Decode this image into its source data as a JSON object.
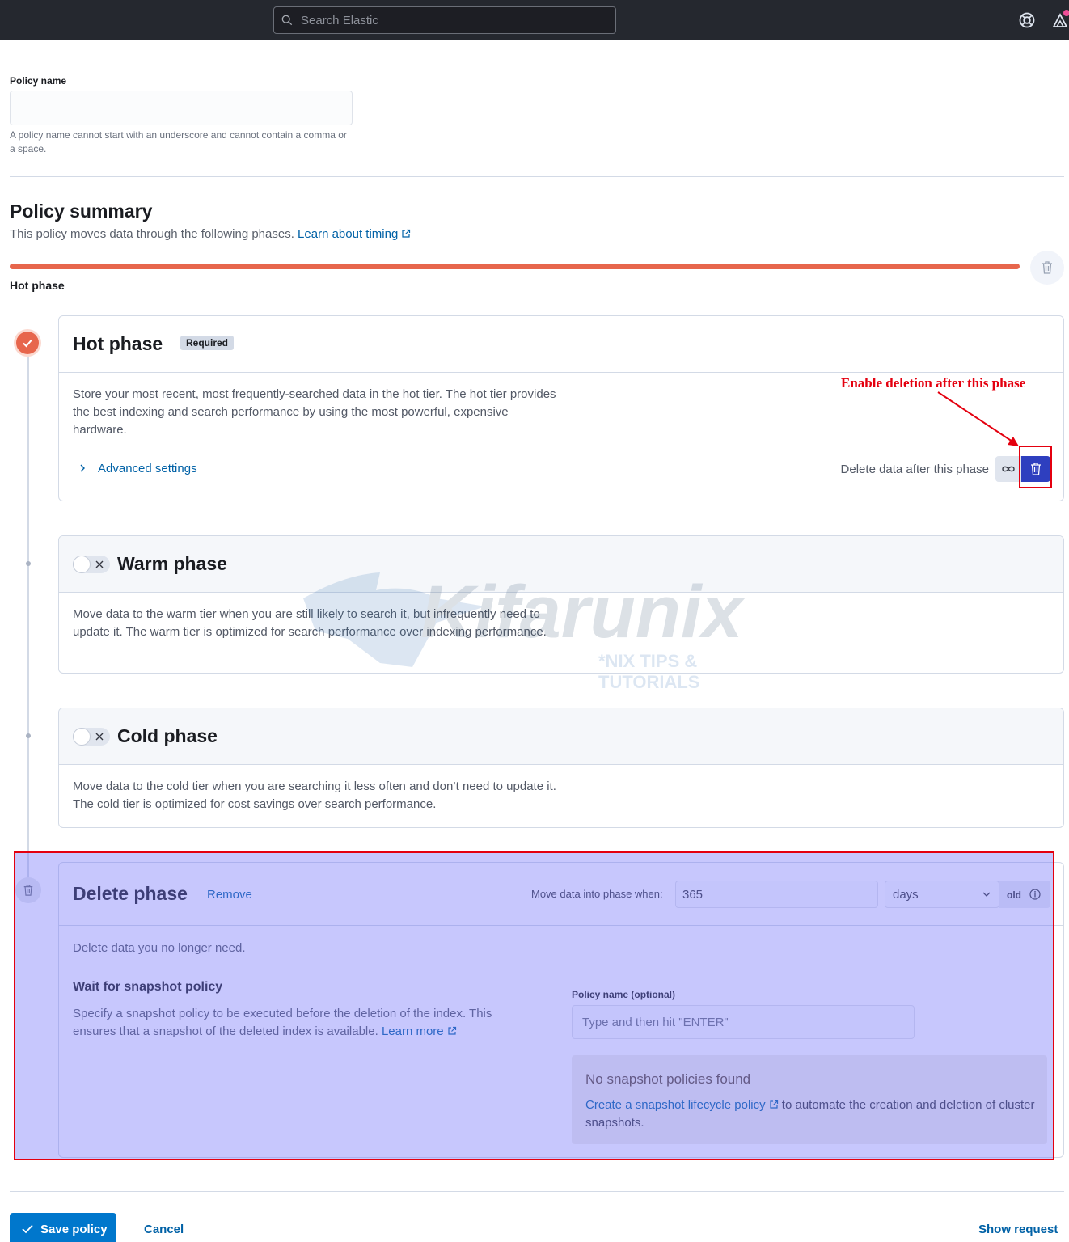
{
  "topbar": {
    "search_placeholder": "Search Elastic"
  },
  "policy_name": {
    "label": "Policy name",
    "value": "",
    "help": "A policy name cannot start with an underscore and cannot contain a comma or a space."
  },
  "summary": {
    "title": "Policy summary",
    "subtitle": "This policy moves data through the following phases.",
    "link": "Learn about timing",
    "phase_label": "Hot phase"
  },
  "phases": {
    "hot": {
      "title": "Hot phase",
      "badge": "Required",
      "description": "Store your most recent, most frequently-searched data in the hot tier. The hot tier provides the best indexing and search performance by using the most powerful, expensive hardware.",
      "advanced": "Advanced settings",
      "delete_after": "Delete data after this phase"
    },
    "warm": {
      "title": "Warm phase",
      "description": "Move data to the warm tier when you are still likely to search it, but infrequently need to update it. The warm tier is optimized for search performance over indexing performance."
    },
    "cold": {
      "title": "Cold phase",
      "description": "Move data to the cold tier when you are searching it less often and don’t need to update it. The cold tier is optimized for cost savings over search performance."
    },
    "delete": {
      "title": "Delete phase",
      "remove": "Remove",
      "move_label": "Move data into phase when:",
      "move_value": "365",
      "unit": "days",
      "old": "old",
      "description": "Delete data you no longer need.",
      "wait_title": "Wait for snapshot policy",
      "wait_desc": "Specify a snapshot policy to be executed before the deletion of the index. This ensures that a snapshot of the deleted index is available.",
      "wait_link": "Learn more",
      "policy_label": "Policy name (optional)",
      "policy_placeholder": "Type and then hit \"ENTER\"",
      "callout_title": "No snapshot policies found",
      "callout_link": "Create a snapshot lifecycle policy",
      "callout_text": "to automate the creation and deletion of cluster snapshots."
    }
  },
  "annotation": {
    "text": "Enable deletion after this phase",
    "color": "#e4000f"
  },
  "watermark": {
    "brand": "Kifarunix",
    "tagline": "*NIX TIPS & TUTORIALS"
  },
  "footer": {
    "save": "Save policy",
    "cancel": "Cancel",
    "show_request": "Show request"
  },
  "colors": {
    "hot": "#e7664c",
    "primary": "#0077cc",
    "link": "#0061a6",
    "danger": "#2e3fbf"
  }
}
